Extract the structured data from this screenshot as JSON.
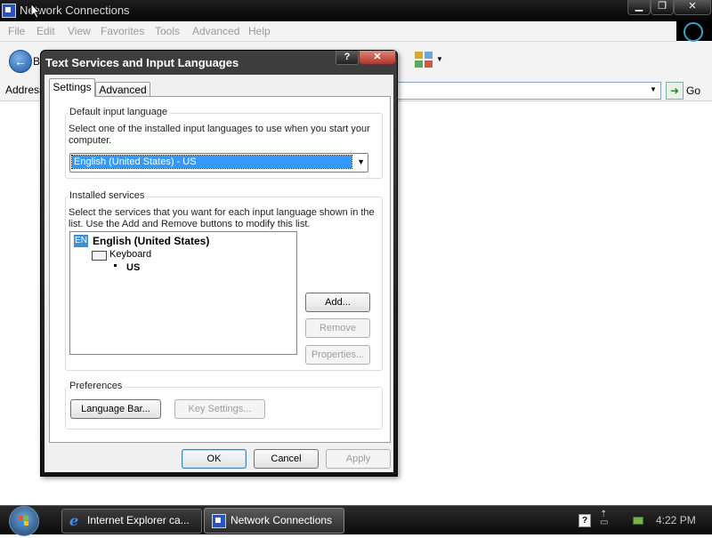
{
  "window": {
    "title": "Network Connections",
    "menu": [
      "File",
      "Edit",
      "View",
      "Favorites",
      "Tools",
      "Advanced",
      "Help"
    ],
    "back_label": "B",
    "address_label": "Address",
    "go_label": "Go",
    "controls": {
      "minimize": "▁",
      "maximize": "❐",
      "close": "✕"
    }
  },
  "dialog": {
    "title": "Text Services and Input Languages",
    "help_glyph": "?",
    "close_glyph": "✕",
    "tabs": [
      {
        "label": "Settings",
        "selected": true
      },
      {
        "label": "Advanced",
        "selected": false
      }
    ],
    "default_input": {
      "group_label": "Default input language",
      "description": "Select one of the installed input languages to use when you start your computer.",
      "selected": "English (United States) - US"
    },
    "installed_services": {
      "group_label": "Installed services",
      "description": "Select the services that you want for each input language shown in the list. Use the Add and Remove buttons to modify this list.",
      "tree": {
        "lang_badge": "EN",
        "language": "English (United States)",
        "category": "Keyboard",
        "layout": "US"
      },
      "buttons": {
        "add": "Add...",
        "remove": "Remove",
        "properties": "Properties..."
      }
    },
    "preferences": {
      "group_label": "Preferences",
      "language_bar": "Language Bar...",
      "key_settings": "Key Settings..."
    },
    "footer": {
      "ok": "OK",
      "cancel": "Cancel",
      "apply": "Apply"
    }
  },
  "taskbar": {
    "items": [
      {
        "label": "Internet Explorer ca...",
        "active": false
      },
      {
        "label": "Network Connections",
        "active": true
      }
    ],
    "clock": "4:22 PM"
  },
  "colors": {
    "selection": "#3399ff",
    "taskbar": "#141414",
    "dialog_frame": "#2a2a2a"
  }
}
